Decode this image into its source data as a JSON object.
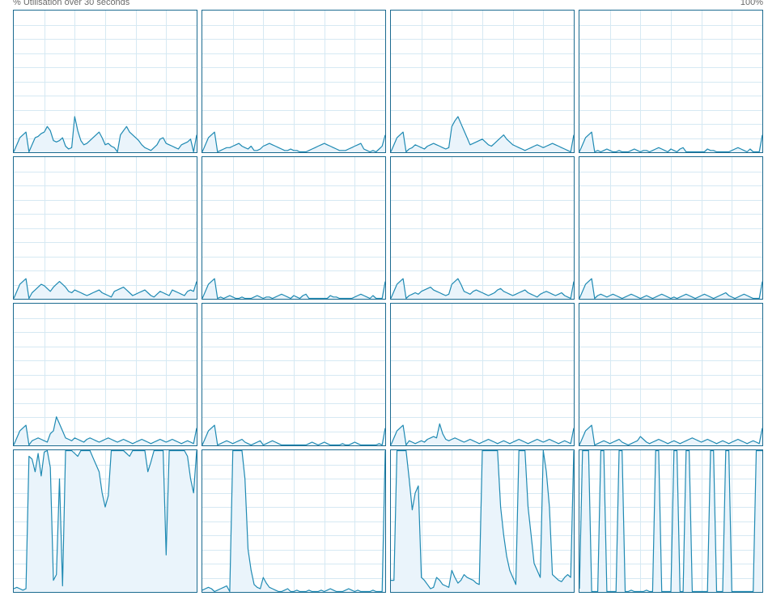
{
  "header": {
    "title": "% Utilisation over 30 seconds",
    "max_label": "100%"
  },
  "colors": {
    "border": "#1c6b90",
    "line": "#1f8ab3",
    "fill": "#eaf4fb",
    "grid": "#d6e9f3",
    "background": "#ffffff"
  },
  "chart_data": {
    "type": "area",
    "ylim": [
      0,
      100
    ],
    "xlim": [
      0,
      60
    ],
    "samples_per_graph": 61,
    "grid": true,
    "rows": 4,
    "cols": 4,
    "cores": [
      {
        "id": 1,
        "values": [
          0,
          5,
          10,
          12,
          14,
          0,
          5,
          10,
          11,
          13,
          14,
          18,
          15,
          8,
          7,
          8,
          10,
          4,
          2,
          3,
          25,
          15,
          8,
          5,
          6,
          8,
          10,
          12,
          14,
          10,
          5,
          6,
          4,
          3,
          0,
          12,
          15,
          18,
          14,
          12,
          10,
          8,
          5,
          3,
          2,
          1,
          3,
          5,
          9,
          10,
          6,
          5,
          4,
          3,
          2,
          5,
          6,
          7,
          9,
          0,
          12
        ]
      },
      {
        "id": 2,
        "values": [
          0,
          5,
          10,
          12,
          14,
          0,
          1,
          2,
          3,
          3,
          4,
          5,
          6,
          4,
          3,
          2,
          4,
          1,
          1,
          2,
          4,
          5,
          6,
          5,
          4,
          3,
          2,
          1,
          1,
          2,
          1,
          1,
          0,
          0,
          0,
          1,
          2,
          3,
          4,
          5,
          6,
          5,
          4,
          3,
          2,
          1,
          1,
          1,
          2,
          3,
          4,
          5,
          6,
          2,
          1,
          0,
          1,
          0,
          2,
          4,
          12
        ]
      },
      {
        "id": 3,
        "values": [
          0,
          5,
          10,
          12,
          14,
          0,
          2,
          3,
          5,
          4,
          3,
          2,
          4,
          5,
          6,
          5,
          4,
          3,
          2,
          3,
          18,
          22,
          25,
          20,
          15,
          10,
          5,
          6,
          7,
          8,
          9,
          7,
          5,
          4,
          6,
          8,
          10,
          12,
          9,
          7,
          5,
          4,
          3,
          2,
          1,
          2,
          3,
          4,
          5,
          4,
          3,
          4,
          5,
          6,
          5,
          4,
          3,
          2,
          1,
          0,
          12
        ]
      },
      {
        "id": 4,
        "values": [
          0,
          5,
          10,
          12,
          14,
          0,
          1,
          0,
          1,
          2,
          1,
          0,
          0,
          1,
          0,
          0,
          0,
          1,
          2,
          1,
          0,
          1,
          1,
          0,
          1,
          2,
          3,
          2,
          1,
          0,
          2,
          1,
          0,
          2,
          3,
          0,
          0,
          0,
          0,
          0,
          0,
          0,
          2,
          1,
          1,
          0,
          0,
          0,
          0,
          0,
          1,
          2,
          3,
          2,
          1,
          0,
          2,
          0,
          0,
          0,
          12
        ]
      },
      {
        "id": 5,
        "values": [
          0,
          5,
          10,
          12,
          14,
          0,
          4,
          6,
          8,
          10,
          9,
          7,
          5,
          8,
          10,
          12,
          10,
          8,
          5,
          4,
          6,
          5,
          4,
          3,
          2,
          3,
          4,
          5,
          6,
          4,
          3,
          2,
          1,
          5,
          6,
          7,
          8,
          6,
          4,
          2,
          3,
          4,
          5,
          6,
          4,
          2,
          1,
          3,
          5,
          4,
          3,
          2,
          6,
          5,
          4,
          3,
          2,
          5,
          6,
          5,
          12
        ]
      },
      {
        "id": 6,
        "values": [
          0,
          5,
          10,
          12,
          14,
          0,
          1,
          0,
          1,
          2,
          1,
          0,
          0,
          1,
          0,
          0,
          0,
          1,
          2,
          1,
          0,
          1,
          1,
          0,
          1,
          2,
          3,
          2,
          1,
          0,
          2,
          1,
          0,
          2,
          3,
          0,
          0,
          0,
          0,
          0,
          0,
          0,
          2,
          1,
          1,
          0,
          0,
          0,
          0,
          0,
          1,
          2,
          3,
          2,
          1,
          0,
          2,
          0,
          0,
          0,
          12
        ]
      },
      {
        "id": 7,
        "values": [
          0,
          5,
          10,
          12,
          14,
          0,
          2,
          3,
          4,
          3,
          5,
          6,
          7,
          8,
          6,
          5,
          4,
          3,
          2,
          3,
          10,
          12,
          14,
          10,
          5,
          4,
          3,
          5,
          6,
          5,
          4,
          3,
          2,
          3,
          4,
          6,
          7,
          5,
          4,
          3,
          2,
          3,
          4,
          5,
          6,
          4,
          3,
          2,
          1,
          3,
          4,
          5,
          4,
          3,
          2,
          3,
          4,
          2,
          1,
          0,
          12
        ]
      },
      {
        "id": 8,
        "values": [
          0,
          5,
          10,
          12,
          14,
          0,
          2,
          3,
          2,
          1,
          2,
          3,
          2,
          1,
          0,
          1,
          2,
          3,
          2,
          1,
          0,
          1,
          2,
          1,
          0,
          1,
          2,
          3,
          2,
          1,
          0,
          1,
          0,
          1,
          2,
          3,
          2,
          1,
          0,
          1,
          2,
          3,
          2,
          1,
          0,
          1,
          2,
          3,
          4,
          2,
          1,
          0,
          1,
          2,
          3,
          2,
          1,
          0,
          0,
          0,
          12
        ]
      },
      {
        "id": 9,
        "values": [
          0,
          5,
          10,
          12,
          14,
          0,
          3,
          4,
          5,
          4,
          3,
          2,
          8,
          10,
          20,
          15,
          10,
          5,
          4,
          3,
          5,
          4,
          3,
          2,
          4,
          5,
          4,
          3,
          2,
          3,
          4,
          5,
          4,
          3,
          2,
          3,
          4,
          3,
          2,
          1,
          2,
          3,
          4,
          3,
          2,
          1,
          2,
          3,
          4,
          3,
          2,
          3,
          4,
          3,
          2,
          1,
          2,
          3,
          2,
          1,
          12
        ]
      },
      {
        "id": 10,
        "values": [
          0,
          5,
          10,
          12,
          14,
          0,
          1,
          2,
          3,
          2,
          1,
          2,
          3,
          4,
          2,
          1,
          0,
          1,
          2,
          3,
          0,
          1,
          2,
          3,
          2,
          1,
          0,
          0,
          0,
          0,
          0,
          0,
          0,
          0,
          0,
          1,
          2,
          1,
          0,
          1,
          2,
          1,
          0,
          0,
          0,
          0,
          1,
          0,
          0,
          1,
          2,
          1,
          0,
          0,
          0,
          0,
          0,
          0,
          1,
          0,
          12
        ]
      },
      {
        "id": 11,
        "values": [
          0,
          5,
          10,
          12,
          14,
          0,
          3,
          2,
          1,
          2,
          3,
          2,
          4,
          5,
          6,
          5,
          15,
          8,
          4,
          3,
          4,
          5,
          4,
          3,
          2,
          3,
          4,
          3,
          2,
          1,
          2,
          3,
          4,
          3,
          2,
          1,
          2,
          3,
          2,
          1,
          2,
          3,
          4,
          3,
          2,
          1,
          2,
          3,
          4,
          3,
          2,
          3,
          4,
          3,
          2,
          1,
          2,
          3,
          2,
          1,
          12
        ]
      },
      {
        "id": 12,
        "values": [
          0,
          5,
          10,
          12,
          14,
          0,
          1,
          2,
          3,
          2,
          1,
          2,
          3,
          4,
          2,
          1,
          0,
          1,
          2,
          3,
          6,
          4,
          2,
          1,
          2,
          3,
          4,
          3,
          2,
          1,
          2,
          3,
          2,
          1,
          2,
          3,
          4,
          5,
          4,
          3,
          2,
          3,
          4,
          3,
          2,
          1,
          2,
          3,
          2,
          1,
          2,
          3,
          4,
          3,
          2,
          1,
          2,
          3,
          2,
          1,
          12
        ]
      },
      {
        "id": 13,
        "values": [
          2,
          3,
          2,
          1,
          2,
          96,
          94,
          85,
          98,
          82,
          99,
          100,
          88,
          8,
          12,
          80,
          4,
          100,
          100,
          100,
          98,
          96,
          100,
          100,
          100,
          100,
          95,
          90,
          85,
          70,
          60,
          68,
          100,
          100,
          100,
          100,
          100,
          98,
          96,
          100,
          100,
          100,
          100,
          100,
          85,
          92,
          100,
          100,
          100,
          100,
          26,
          100,
          100,
          100,
          100,
          100,
          100,
          96,
          80,
          70,
          100
        ]
      },
      {
        "id": 14,
        "values": [
          1,
          2,
          3,
          2,
          0,
          1,
          2,
          3,
          4,
          0,
          100,
          100,
          100,
          100,
          80,
          30,
          15,
          5,
          3,
          2,
          10,
          6,
          3,
          2,
          1,
          0,
          0,
          1,
          2,
          0,
          0,
          1,
          0,
          0,
          0,
          1,
          0,
          0,
          0,
          1,
          0,
          1,
          2,
          1,
          0,
          0,
          0,
          1,
          2,
          1,
          0,
          1,
          0,
          0,
          0,
          0,
          1,
          0,
          0,
          0,
          100
        ]
      },
      {
        "id": 15,
        "values": [
          8,
          8,
          100,
          100,
          100,
          100,
          80,
          58,
          70,
          75,
          10,
          8,
          5,
          2,
          3,
          10,
          8,
          5,
          4,
          3,
          15,
          10,
          6,
          8,
          12,
          10,
          9,
          8,
          6,
          5,
          100,
          100,
          100,
          100,
          100,
          100,
          60,
          40,
          25,
          15,
          10,
          5,
          100,
          100,
          100,
          60,
          40,
          20,
          15,
          10,
          100,
          85,
          60,
          12,
          10,
          8,
          7,
          10,
          12,
          10,
          100
        ]
      },
      {
        "id": 16,
        "values": [
          2,
          100,
          100,
          100,
          0,
          0,
          0,
          100,
          100,
          0,
          0,
          0,
          0,
          100,
          100,
          0,
          0,
          1,
          0,
          0,
          0,
          0,
          1,
          0,
          0,
          100,
          100,
          0,
          0,
          0,
          0,
          100,
          100,
          0,
          0,
          100,
          100,
          0,
          0,
          0,
          0,
          0,
          0,
          100,
          100,
          0,
          0,
          0,
          100,
          100,
          0,
          0,
          0,
          0,
          0,
          0,
          0,
          0,
          100,
          100,
          100
        ]
      }
    ]
  }
}
